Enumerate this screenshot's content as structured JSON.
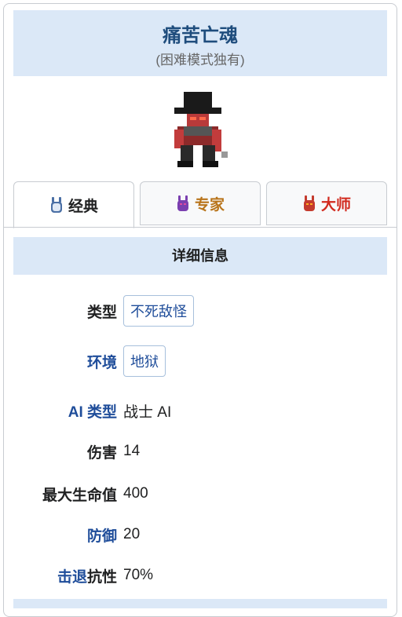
{
  "header": {
    "title": "痛苦亡魂",
    "subtitle": "(困难模式独有)"
  },
  "tabs": [
    {
      "label": "经典",
      "color": "#202122",
      "icon_color": "#4a6fa5"
    },
    {
      "label": "专家",
      "color": "#b8741a",
      "icon_color": "#7a3fb0"
    },
    {
      "label": "大师",
      "color": "#d12a1e",
      "icon_color": "#c43b2e"
    }
  ],
  "section": {
    "title": "详细信息"
  },
  "stats": {
    "type_label": "类型",
    "type_value": "不死敌怪",
    "env_label": "环境",
    "env_value": "地狱",
    "ai_label": "AI 类型",
    "ai_value": "战士 AI",
    "damage_label": "伤害",
    "damage_value": "14",
    "hp_label": "最大生命值",
    "hp_value": "400",
    "defense_label": "防御",
    "defense_value": "20",
    "kb_label_link": "击退",
    "kb_label_rest": "抗性",
    "kb_value": "70%"
  }
}
